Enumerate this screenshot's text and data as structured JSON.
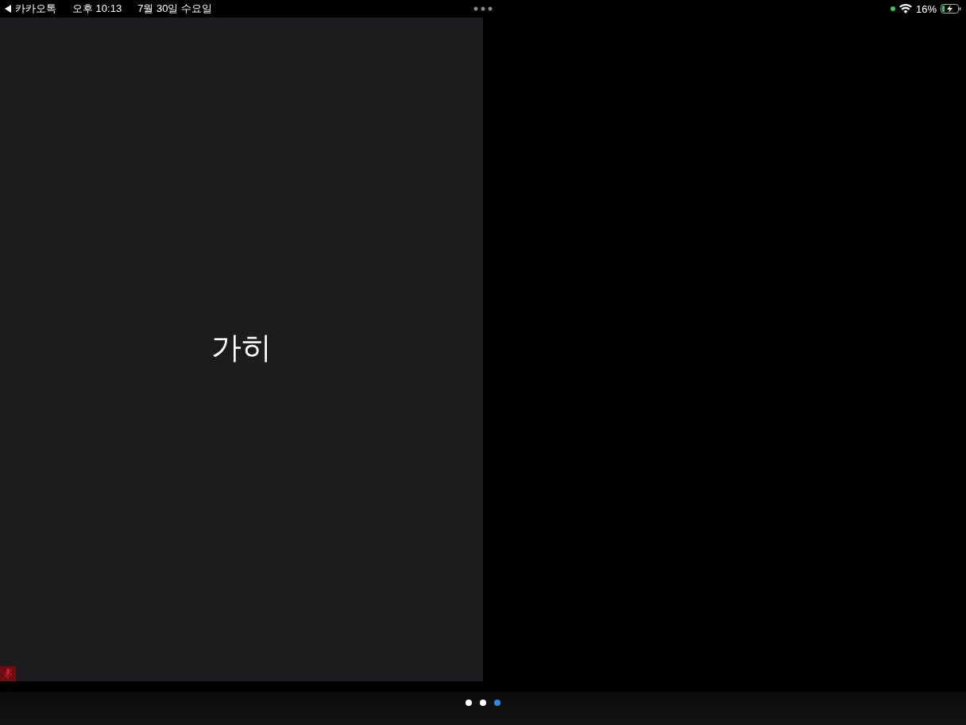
{
  "status_bar": {
    "back_app": "카카오톡",
    "time": "오후 10:13",
    "date": "7월 30일 수요일",
    "battery": "16%",
    "charging": true
  },
  "participant": {
    "name": "가히",
    "muted": true
  },
  "page_dots": [
    {
      "selected": false
    },
    {
      "selected": false
    },
    {
      "selected": true
    }
  ]
}
